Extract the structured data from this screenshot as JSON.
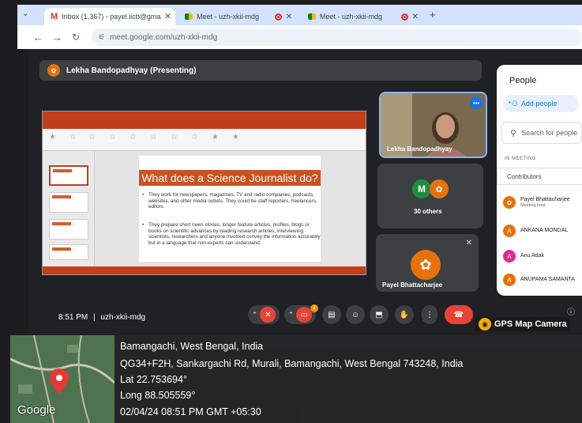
{
  "browser": {
    "tabs": [
      {
        "label": "Inbox (1,367) - payel.iicb@gma"
      },
      {
        "label": "Meet - uzh-xkii-mdg"
      },
      {
        "label": "Meet - uzh-xkii-mdg"
      }
    ],
    "new_tab": "+",
    "url": "meet.google.com/uzh-xkii-mdg"
  },
  "presenter": {
    "label": "Lekha Bandopadhyay (Presenting)"
  },
  "slide": {
    "title": "What does a Science Journalist do?",
    "bullets": [
      "They work for newspapers, magazines, TV and radio companies, podcasts, websites, and other media outlets. They could be staff reporters, freelancers, editors",
      "They prepare short news stories, longer feature articles, profiles, blogs or books on scientific advances by reading research articles, interviewing scientists, researchers and anyone involved convey the information accurately but in a language that non-experts can understand."
    ]
  },
  "tiles": {
    "lekha": "Lekha Bandopadhyay",
    "others_initial": "M",
    "others": "30 others",
    "payel": "Payel Bhattacharjee"
  },
  "people_panel": {
    "title": "People",
    "add_people": "Add people",
    "search_placeholder": "Search for people",
    "section": "IN MEETING",
    "group": "Contributors",
    "participants": [
      {
        "name": "Payel Bhattacharjee",
        "sub": "Meeting host",
        "initial": "",
        "color": "#e8710a"
      },
      {
        "name": "ANKANA MONDAL",
        "sub": "",
        "initial": "A",
        "color": "#e8710a"
      },
      {
        "name": "Anu Adak",
        "sub": "",
        "initial": "A",
        "color": "#e52592"
      },
      {
        "name": "ANUPAMA SAMANTA",
        "sub": "",
        "initial": "A",
        "color": "#e8710a"
      }
    ]
  },
  "meeting": {
    "time": "8:51 PM",
    "separator": "|",
    "code": "uzh-xkii-mdg",
    "notification_count": "1"
  },
  "gps": {
    "badge": "GPS Map Camera",
    "place": "Bamangachi, West Bengal, India",
    "address": "QG34+F2H, Sankargachi Rd, Murali, Bamangachi, West Bengal 743248, India",
    "lat": "Lat 22.753694°",
    "long": "Long 88.505559°",
    "datetime": "02/04/24 08:51 PM GMT +05:30",
    "map_brand": "Google"
  }
}
